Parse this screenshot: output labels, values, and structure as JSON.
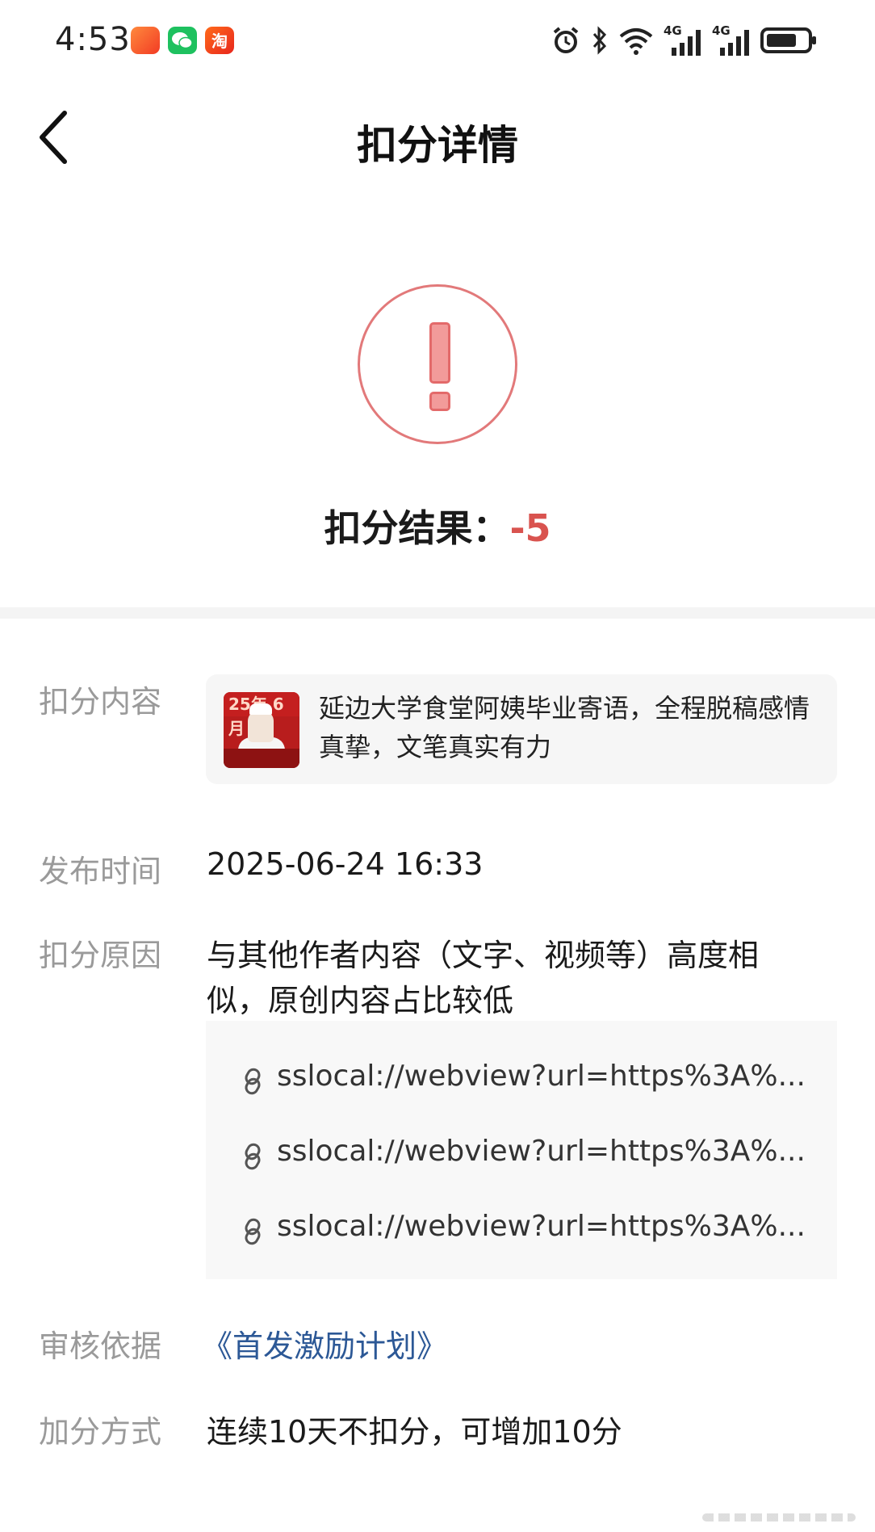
{
  "status_bar": {
    "time": "4:53",
    "apps": [
      {
        "icon": "xianyu-app-icon",
        "color": "#f23b24"
      },
      {
        "icon": "wechat-app-icon",
        "color": "#1ec15f"
      },
      {
        "icon": "taobao-app-icon",
        "color": "#e8261d",
        "glyph": "淘"
      }
    ],
    "network_labels": [
      "4G",
      "4G"
    ],
    "icons": [
      "alarm-icon",
      "bluetooth-icon",
      "wifi-icon",
      "signal-icon",
      "signal-icon",
      "battery-icon"
    ]
  },
  "header": {
    "title": "扣分详情",
    "back_icon": "chevron-left-icon"
  },
  "result": {
    "icon": "exclamation-circle-icon",
    "label": "扣分结果：",
    "value": "-5",
    "value_color": "#d9534f"
  },
  "details": {
    "content_label": "扣分内容",
    "content_thumb_text": "25年 6月",
    "content_title": "延边大学食堂阿姨毕业寄语，全程脱稿感情真挚，文笔真实有力",
    "publish_label": "发布时间",
    "publish_time": "2025-06-24 16:33",
    "reason_label": "扣分原因",
    "reason_text_line1": "与其他作者内容（文字、视频等）高度相",
    "reason_text_line2": "似，原创内容占比较低",
    "links": [
      "sslocal://webview?url=https%3A%...",
      "sslocal://webview?url=https%3A%...",
      "sslocal://webview?url=https%3A%..."
    ],
    "basis_label": "审核依据",
    "basis_link": "《首发激励计划》",
    "bonus_label": "加分方式",
    "bonus_text": "连续10天不扣分，可增加10分"
  },
  "colors": {
    "accent_red": "#d9534f",
    "link_blue": "#2c5896",
    "label_gray": "#9a9a9a"
  }
}
